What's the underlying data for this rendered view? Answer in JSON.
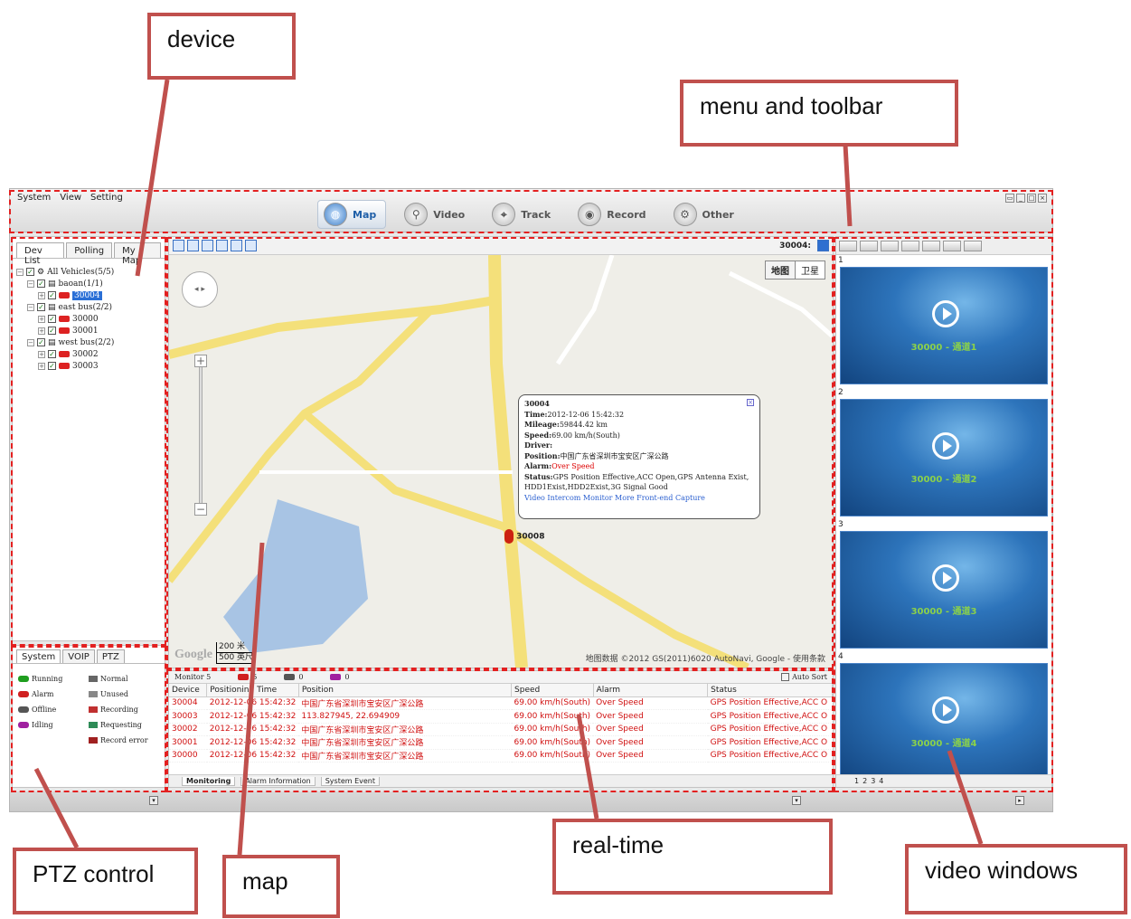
{
  "menu": {
    "items": [
      "System",
      "View",
      "Setting"
    ]
  },
  "main_tabs": [
    {
      "label": "Map",
      "icon": "globe-icon",
      "active": true
    },
    {
      "label": "Video",
      "icon": "magnifier-icon",
      "active": false
    },
    {
      "label": "Track",
      "icon": "track-icon",
      "active": false
    },
    {
      "label": "Record",
      "icon": "record-icon",
      "active": false
    },
    {
      "label": "Other",
      "icon": "gear-icon",
      "active": false
    }
  ],
  "left_tabs": [
    "Dev List",
    "Polling",
    "My Map"
  ],
  "tree": {
    "root": "All Vehicles(5/5)",
    "groups": [
      {
        "name": "baoan(1/1)",
        "vehicles": [
          "30004"
        ]
      },
      {
        "name": "east bus(2/2)",
        "vehicles": [
          "30000",
          "30001"
        ]
      },
      {
        "name": "west bus(2/2)",
        "vehicles": [
          "30002",
          "30003"
        ]
      }
    ]
  },
  "status_tabs": [
    "System",
    "VOIP",
    "PTZ"
  ],
  "status_legend": [
    {
      "label": "Running",
      "color": "#1f9e1f"
    },
    {
      "label": "Normal",
      "color": "#666666"
    },
    {
      "label": "Alarm",
      "color": "#d02020"
    },
    {
      "label": "Unused",
      "color": "#888888"
    },
    {
      "label": "Offline",
      "color": "#555555"
    },
    {
      "label": "Recording",
      "color": "#c03030"
    },
    {
      "label": "Idling",
      "color": "#a020a0"
    },
    {
      "label": "Requesting",
      "color": "#2e8b57"
    },
    {
      "label": "",
      "color": "#ffffff"
    },
    {
      "label": "Record error",
      "color": "#a02020"
    }
  ],
  "map": {
    "vehicle_label": "30004:",
    "map_types": [
      "地图",
      "卫星"
    ],
    "copyright": "地图数据 ©2012 GS(2011)6020 AutoNavi, Google - 使用条款",
    "google": "Google",
    "scale_top": "200 米",
    "scale_bottom": "500 英尺",
    "marker": "30008"
  },
  "popup": {
    "id": "30004",
    "time_label": "Time:",
    "time": "2012-12-06 15:42:32",
    "mileage_label": "Mileage:",
    "mileage": "59844.42 km",
    "speed_label": "Speed:",
    "speed": "69.00 km/h(South)",
    "driver_label": "Driver:",
    "position_label": "Position:",
    "position": "中国广东省深圳市宝安区广深公路",
    "alarm_label": "Alarm:",
    "alarm": "Over Speed",
    "status_label": "Status:",
    "status": "GPS Position Effective,ACC Open,GPS Antenna Exist, HDD1Exist,HDD2Exist,3G Signal Good",
    "links": "Video  Intercom  Monitor  More  Front-end Capture"
  },
  "realtime": {
    "monitor_label": "Monitor",
    "monitor_count": "5",
    "counts": [
      {
        "color": "#d02020",
        "value": "5"
      },
      {
        "color": "#555555",
        "value": "0"
      },
      {
        "color": "#a020a0",
        "value": "0"
      }
    ],
    "auto_sort": "Auto Sort",
    "columns": [
      "Device",
      "Positioning Time",
      "Position",
      "Speed",
      "Alarm",
      "Status"
    ],
    "rows": [
      [
        "30004",
        "2012-12-06 15:42:32",
        "中国广东省深圳市宝安区广深公路",
        "69.00 km/h(South)",
        "Over Speed",
        "GPS Position Effective,ACC O"
      ],
      [
        "30003",
        "2012-12-06 15:42:32",
        "113.827945, 22.694909",
        "69.00 km/h(South)",
        "Over Speed",
        "GPS Position Effective,ACC O"
      ],
      [
        "30002",
        "2012-12-06 15:42:32",
        "中国广东省深圳市宝安区广深公路",
        "69.00 km/h(South)",
        "Over Speed",
        "GPS Position Effective,ACC O"
      ],
      [
        "30001",
        "2012-12-06 15:42:32",
        "中国广东省深圳市宝安区广深公路",
        "69.00 km/h(South)",
        "Over Speed",
        "GPS Position Effective,ACC O"
      ],
      [
        "30000",
        "2012-12-06 15:42:32",
        "中国广东省深圳市宝安区广深公路",
        "69.00 km/h(South)",
        "Over Speed",
        "GPS Position Effective,ACC O"
      ]
    ],
    "tabs": [
      "Monitoring",
      "Alarm Information",
      "System Event"
    ]
  },
  "video": {
    "windows": [
      {
        "num": "1",
        "caption": "30000 - 通道1"
      },
      {
        "num": "2",
        "caption": "30000 - 通道2"
      },
      {
        "num": "3",
        "caption": "30000 - 通道3"
      },
      {
        "num": "4",
        "caption": "30000 - 通道4"
      }
    ],
    "pages": [
      "1",
      "2",
      "3",
      "4"
    ]
  },
  "annotations": [
    "device",
    "menu and toolbar",
    "PTZ control",
    "map",
    "real-time",
    "video windows"
  ],
  "annotation_color": "#c0504d"
}
